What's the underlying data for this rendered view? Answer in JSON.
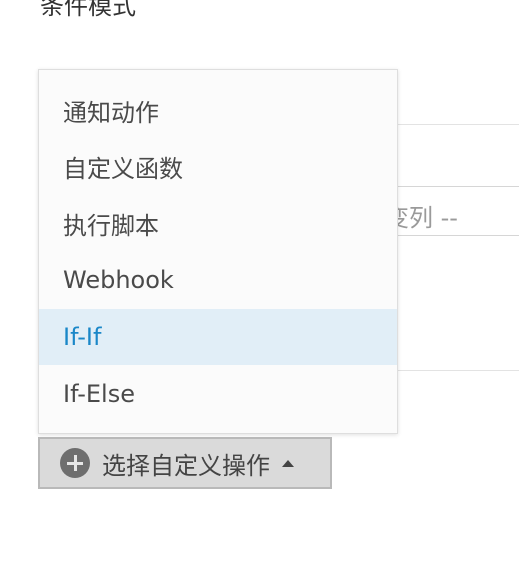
{
  "page": {
    "cut_heading": "条件模式",
    "background_field_text": "变列 --"
  },
  "menu": {
    "items": [
      {
        "label": "通知动作",
        "active": false
      },
      {
        "label": "自定义函数",
        "active": false
      },
      {
        "label": "执行脚本",
        "active": false
      },
      {
        "label": "Webhook",
        "active": false
      },
      {
        "label": "If-If",
        "active": true
      },
      {
        "label": "If-Else",
        "active": false
      }
    ]
  },
  "trigger": {
    "label": "选择自定义操作",
    "icon": "plus-circle-icon",
    "caret": "caret-up-icon"
  },
  "colors": {
    "active_bg": "#e1eef7",
    "active_text": "#1a87c8",
    "button_bg": "#dadada"
  }
}
